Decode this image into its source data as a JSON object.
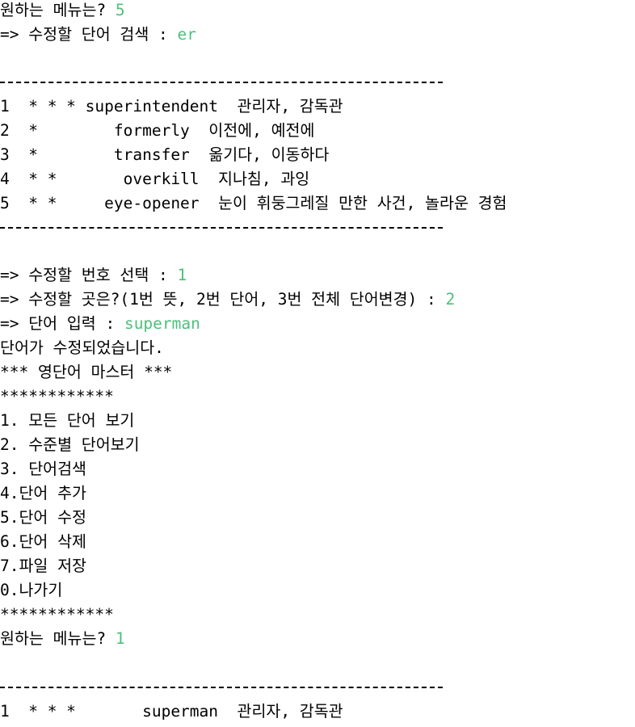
{
  "session1": {
    "menu_prompt": "원하는 메뉴는? ",
    "menu_choice": "5",
    "search_prompt": "=> 수정할 단어 검색 : ",
    "search_input": "er",
    "divider": "-------------------------------------",
    "results": [
      {
        "line": "1  * * * superintendent  관리자, 감독관"
      },
      {
        "line": "2  *        formerly  이전에, 예전에"
      },
      {
        "line": "3  *        transfer  옮기다, 이동하다"
      },
      {
        "line": "4  * *       overkill  지나침, 과잉"
      },
      {
        "line": "5  * *     eye-opener  눈이 휘둥그레질 만한 사건, 놀라운 경험"
      }
    ],
    "select_prompt": "=> 수정할 번호 선택 : ",
    "select_input": "1",
    "field_prompt": "=> 수정할 곳은?(1번 뜻, 2번 단어, 3번 전체 단어변경) : ",
    "field_input": "2",
    "word_prompt": "=> 단어 입력 : ",
    "word_input": "superman",
    "confirm_message": "단어가 수정되었습니다."
  },
  "menu": {
    "title": "*** 영단어 마스터 ***",
    "border": "************",
    "items": [
      {
        "label": "1. 모든 단어 보기"
      },
      {
        "label": "2. 수준별 단어보기"
      },
      {
        "label": "3. 단어검색"
      },
      {
        "label": "4.단어 추가"
      },
      {
        "label": "5.단어 수정"
      },
      {
        "label": "6.단어 삭제"
      },
      {
        "label": "7.파일 저장"
      },
      {
        "label": "0.나가기"
      }
    ],
    "prompt": "원하는 메뉴는? ",
    "choice": "1"
  },
  "session2": {
    "divider": "-------------------------------------",
    "results": [
      {
        "line": "1  * * *       superman  관리자, 감독관"
      }
    ]
  }
}
